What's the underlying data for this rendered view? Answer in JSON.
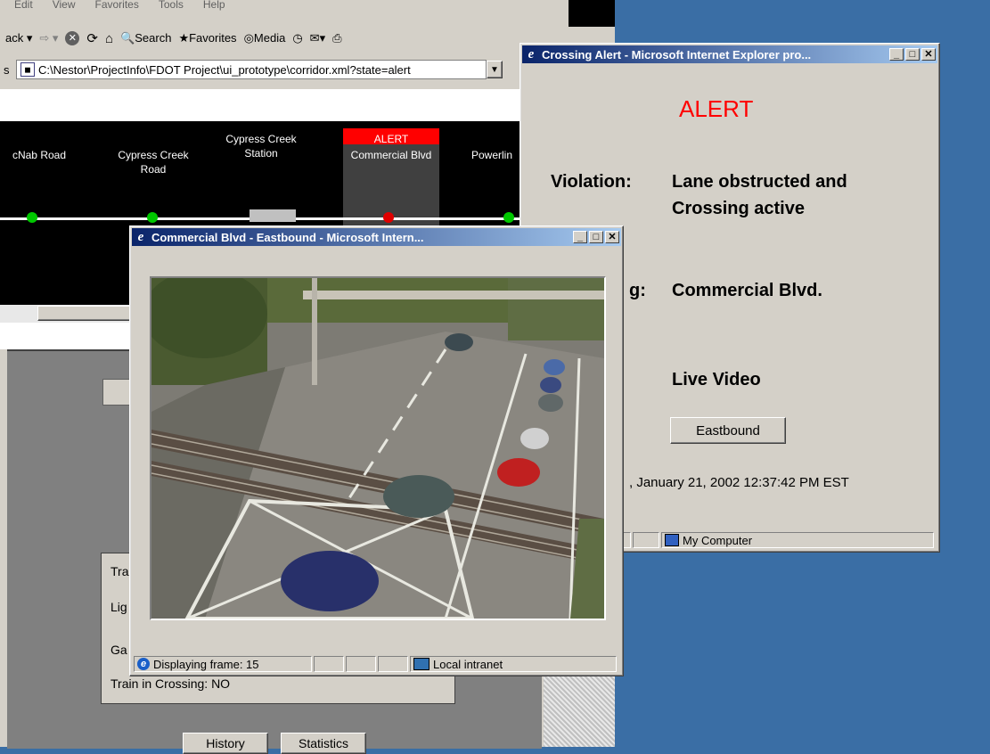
{
  "main_browser": {
    "menu": [
      "Edit",
      "View",
      "Favorites",
      "Tools",
      "Help"
    ],
    "toolbar": {
      "back": "ack",
      "search": "Search",
      "favorites": "Favorites",
      "media": "Media"
    },
    "address_label": "s",
    "address_value": "C:\\Nestor\\ProjectInfo\\FDOT Project\\ui_prototype\\corridor.xml?state=alert",
    "stations": [
      {
        "name": "cNab Road",
        "state": "ok"
      },
      {
        "name": "Cypress Creek Road",
        "state": "ok"
      },
      {
        "name": "Cypress Creek Station",
        "state": "station"
      },
      {
        "name": "Commercial Blvd",
        "state": "alert",
        "badge": "ALERT"
      },
      {
        "name": "Powerlin",
        "state": "ok"
      }
    ],
    "status_panel": {
      "rows": [
        "Tra",
        "Lig",
        "Ga",
        "Train in Crossing:   NO"
      ]
    },
    "buttons": {
      "history": "History",
      "statistics": "Statistics"
    }
  },
  "alert_window": {
    "title": "Crossing Alert - Microsoft Internet Explorer pro...",
    "heading": "ALERT",
    "violation_label": "Violation:",
    "violation_value_1": "Lane obstructed and",
    "violation_value_2": "Crossing active",
    "crossing_label": "g:",
    "crossing_value": "Commercial Blvd.",
    "live_video_label": "Live Video",
    "eastbound_button": "Eastbound",
    "timestamp": ", January 21, 2002 12:37:42 PM EST",
    "status_zone": "My Computer"
  },
  "video_window": {
    "title": "Commercial Blvd - Eastbound - Microsoft Intern...",
    "status_text": "Displaying frame: 15",
    "status_zone": "Local intranet"
  },
  "colors": {
    "desktop": "#3a6ea5",
    "title_active": "#0a246a",
    "alert_red": "#ff0000",
    "ok_green": "#00c800"
  }
}
